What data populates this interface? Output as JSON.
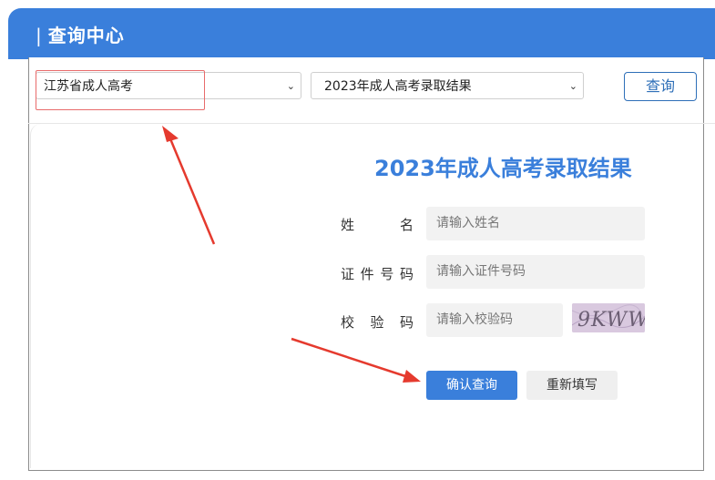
{
  "header": {
    "title": "查询中心"
  },
  "filters": {
    "province_value": "江苏省成人高考",
    "exam_value": "2023年成人高考录取结果",
    "query_label": "查询"
  },
  "form": {
    "title": "2023年成人高考录取结果",
    "name_label": "姓名",
    "name_placeholder": "请输入姓名",
    "id_label": "证件号码",
    "id_placeholder": "请输入证件号码",
    "code_label": "校验码",
    "code_placeholder": "请输入校验码",
    "captcha_text": "9KWW",
    "submit_label": "确认查询",
    "reset_label": "重新填写"
  },
  "colors": {
    "accent": "#3a7fdb",
    "annotation": "#e53a2e"
  }
}
